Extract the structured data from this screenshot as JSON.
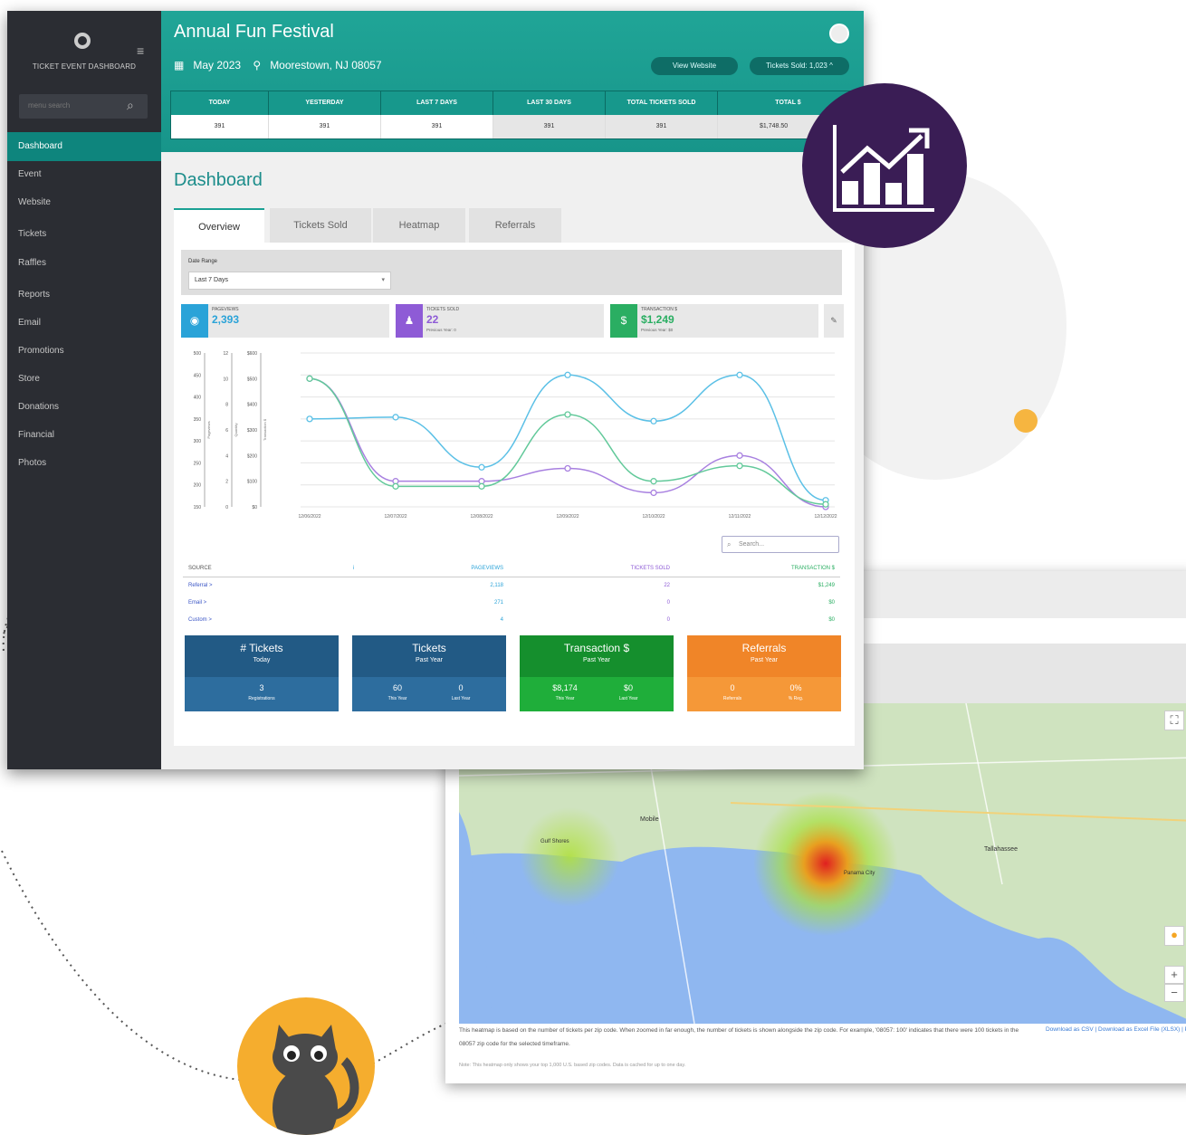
{
  "app": {
    "title": "Annual Fun Festival",
    "date": "May 2023",
    "location": "Moorestown, NJ 08057",
    "brand": "TICKET EVENT DASHBOARD"
  },
  "header": {
    "view_website": "View Website",
    "tickets_sold_pill": "Tickets Sold: 1,023 ^"
  },
  "stats": {
    "headers": [
      "TODAY",
      "YESTERDAY",
      "LAST 7 DAYS",
      "LAST 30 DAYS",
      "TOTAL TICKETS SOLD",
      "TOTAL $"
    ],
    "values": [
      "391",
      "391",
      "391",
      "391",
      "391",
      "$1,748.50"
    ]
  },
  "sidebar": {
    "search_placeholder": "menu search",
    "items": [
      {
        "label": "Dashboard"
      },
      {
        "label": "Event"
      },
      {
        "label": "Website"
      },
      {
        "label": "Tickets"
      },
      {
        "label": "Raffles"
      },
      {
        "label": "Reports"
      },
      {
        "label": "Email"
      },
      {
        "label": "Promotions"
      },
      {
        "label": "Store"
      },
      {
        "label": "Donations"
      },
      {
        "label": "Financial"
      },
      {
        "label": "Photos"
      }
    ]
  },
  "page": {
    "title": "Dashboard"
  },
  "tabs": [
    {
      "label": "Overview"
    },
    {
      "label": "Tickets Sold"
    },
    {
      "label": "Heatmap"
    },
    {
      "label": "Referrals"
    }
  ],
  "filters": {
    "date_range_label": "Date Range",
    "date_range_value": "Last 7 Days"
  },
  "kpis": [
    {
      "label": "PAGEVIEWS",
      "value": "2,393",
      "color": "#2aa3d8",
      "prev": "",
      "icon": "eye-icon"
    },
    {
      "label": "TICKETS SOLD",
      "value": "22",
      "color": "#8e5bd6",
      "prev": "Previous Year: 0",
      "icon": "person-icon"
    },
    {
      "label": "TRANSACTION $",
      "value": "$1,249",
      "color": "#2aae62",
      "prev": "Previous Year: $0",
      "icon": "dollar-icon"
    }
  ],
  "chart_data": {
    "type": "line",
    "x": [
      "12/06/2022",
      "12/07/2022",
      "12/08/2022",
      "12/09/2022",
      "12/10/2022",
      "12/11/2022",
      "12/12/2022"
    ],
    "y_axes": {
      "pageviews": {
        "ticks": [
          "500",
          "450",
          "400",
          "350",
          "300",
          "250",
          "200",
          "150"
        ],
        "label": "Pageviews"
      },
      "tickets": {
        "ticks": [
          "12",
          "10",
          "8",
          "6",
          "4",
          "2",
          "0"
        ],
        "label": "Quantity"
      },
      "transaction": {
        "ticks": [
          "$600",
          "$500",
          "$400",
          "$300",
          "$200",
          "$100",
          "$0"
        ],
        "label": "Transaction $"
      }
    },
    "series": [
      {
        "name": "Pageviews",
        "color": "#5bc0e6",
        "values": [
          350,
          354,
          240,
          450,
          345,
          450,
          165
        ]
      },
      {
        "name": "Tickets Sold",
        "color": "#a880e0",
        "values": [
          10,
          2,
          2,
          3,
          1.1,
          4,
          0
        ]
      },
      {
        "name": "Transaction $",
        "color": "#62c99a",
        "values": [
          500,
          80,
          80,
          360,
          100,
          160,
          10
        ]
      }
    ]
  },
  "table": {
    "search_placeholder": "Search...",
    "headers": [
      "SOURCE",
      "i",
      "PAGEVIEWS",
      "TICKETS SOLD",
      "TRANSACTION $"
    ],
    "rows": [
      {
        "source": "Referral >",
        "pageviews": "2,118",
        "tickets": "22",
        "transaction": "$1,249"
      },
      {
        "source": "Email >",
        "pageviews": "271",
        "tickets": "0",
        "transaction": "$0"
      },
      {
        "source": "Custom >",
        "pageviews": "4",
        "tickets": "0",
        "transaction": "$0"
      }
    ]
  },
  "cards": [
    {
      "title": "# Tickets",
      "subtitle": "Today",
      "top_color": "#225a85",
      "bot_color": "#2d6d9e",
      "values": [
        {
          "v": "3",
          "s": "Registrations"
        }
      ]
    },
    {
      "title": "Tickets",
      "subtitle": "Past Year",
      "top_color": "#225a85",
      "bot_color": "#2d6d9e",
      "values": [
        {
          "v": "60",
          "s": "This Year"
        },
        {
          "v": "0",
          "s": "Last Year"
        }
      ]
    },
    {
      "title": "Transaction $",
      "subtitle": "Past Year",
      "top_color": "#158f2d",
      "bot_color": "#1fae3a",
      "values": [
        {
          "v": "$8,174",
          "s": "This Year"
        },
        {
          "v": "$0",
          "s": "Last Year"
        }
      ]
    },
    {
      "title": "Referrals",
      "subtitle": "Past Year",
      "top_color": "#f08528",
      "bot_color": "#f59838",
      "values": [
        {
          "v": "0",
          "s": "Referrals"
        },
        {
          "v": "0%",
          "s": "% Reg."
        }
      ]
    }
  ],
  "map": {
    "caption": "This heatmap is based on the number of tickets per zip code. When zoomed in far enough, the number of tickets is shown alongside the zip code. For example, '08057: 100' indicates that there were 100 tickets in the 08057 zip code for the selected timeframe.",
    "download": "Download as CSV | Download as Excel File (XLSX) | Print",
    "note": "Note: This heatmap only shows your top 1,000 U.S. based zip codes. Data is cached for up to one day.",
    "labels": [
      "Mobile",
      "Tallahassee",
      "Panama City",
      "Gulf Shores"
    ]
  },
  "colors": {
    "teal": "#1a9e92",
    "sidebar": "#2b2d33",
    "accent_purple": "#3a1d55",
    "accent_orange": "#f5ad2e"
  }
}
